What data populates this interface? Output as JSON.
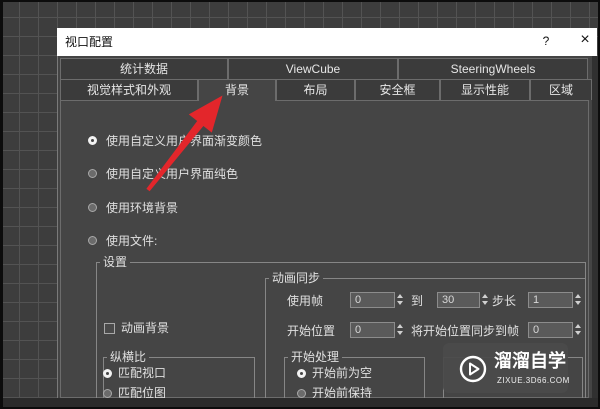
{
  "window": {
    "title": "视口配置",
    "help_label": "?",
    "close_label": "×"
  },
  "tabs": {
    "row1": [
      {
        "label": "统计数据",
        "active": false
      },
      {
        "label": "ViewCube",
        "active": false
      },
      {
        "label": "SteeringWheels",
        "active": false
      }
    ],
    "row2": [
      {
        "label": "视觉样式和外观",
        "active": false
      },
      {
        "label": "背景",
        "active": true
      },
      {
        "label": "布局",
        "active": false
      },
      {
        "label": "安全框",
        "active": false
      },
      {
        "label": "显示性能",
        "active": false
      },
      {
        "label": "区域",
        "active": false
      }
    ]
  },
  "background_options": [
    {
      "label": "使用自定义用户界面渐变颜色",
      "selected": true
    },
    {
      "label": "使用自定义用户界面纯色",
      "selected": false
    },
    {
      "label": "使用环境背景",
      "selected": false
    },
    {
      "label": "使用文件:",
      "selected": false
    }
  ],
  "settings": {
    "title": "设置",
    "animate_background": {
      "label": "动画背景",
      "checked": false
    },
    "anim_sync": {
      "title": "动画同步",
      "use_frame_label": "使用帧",
      "use_frame_start": "0",
      "to_label": "到",
      "use_frame_end": "30",
      "step_label": "步长",
      "step": "1",
      "start_pos_label": "开始位置",
      "start_pos": "0",
      "sync_label": "将开始位置同步到帧",
      "sync_frame": "0"
    },
    "aspect": {
      "title": "纵横比",
      "options": [
        {
          "label": "匹配视口",
          "selected": true
        },
        {
          "label": "匹配位图",
          "selected": false
        }
      ]
    },
    "start_processing": {
      "title": "开始处理",
      "options": [
        {
          "label": "开始前为空",
          "selected": true
        },
        {
          "label": "开始前保持",
          "selected": false
        }
      ]
    }
  },
  "watermark": {
    "name": "溜溜自学",
    "url": "ZIXUE.3D66.COM",
    "icon": "play-circle-icon"
  },
  "colors": {
    "dialog_bg": "#454545",
    "title_bar": "#ffffff",
    "annotation_arrow": "#e3262b"
  }
}
